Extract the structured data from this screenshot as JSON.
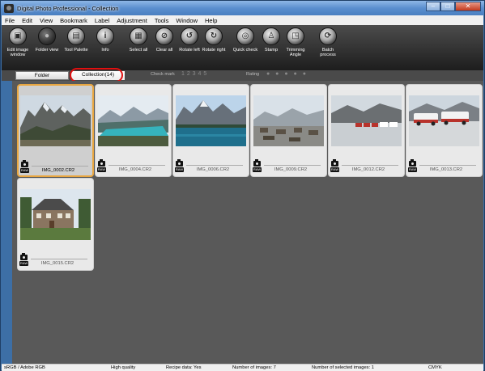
{
  "window": {
    "title": "Digital Photo Professional - Collection"
  },
  "menu": [
    "File",
    "Edit",
    "View",
    "Bookmark",
    "Label",
    "Adjustment",
    "Tools",
    "Window",
    "Help"
  ],
  "toolbar": [
    {
      "label": "Edit image window",
      "icon": "edit-image-icon",
      "glyph": "▣"
    },
    {
      "label": "Folder view",
      "icon": "folder-view-icon",
      "glyph": "●"
    },
    {
      "label": "Tool Palette",
      "icon": "tool-palette-icon",
      "glyph": "▤"
    },
    {
      "label": "Info",
      "icon": "info-icon",
      "glyph": "i"
    },
    {
      "label": "Select all",
      "icon": "select-all-icon",
      "glyph": "▦"
    },
    {
      "label": "Clear all",
      "icon": "clear-all-icon",
      "glyph": "⊘"
    },
    {
      "label": "Rotate left",
      "icon": "rotate-left-icon",
      "glyph": "↺"
    },
    {
      "label": "Rotate right",
      "icon": "rotate-right-icon",
      "glyph": "↻"
    },
    {
      "label": "Quick check",
      "icon": "quick-check-icon",
      "glyph": "◎"
    },
    {
      "label": "Stamp",
      "icon": "stamp-icon",
      "glyph": "♙"
    },
    {
      "label": "Trimming Angle",
      "icon": "trimming-angle-icon",
      "glyph": "◳"
    },
    {
      "label": "Batch process",
      "icon": "batch-process-icon",
      "glyph": "⟳"
    }
  ],
  "tabs": {
    "folder": "Folder",
    "collection": "Collection(14)"
  },
  "filters": {
    "check_mark_label": "Check mark",
    "check_marks": "1 2 3 4 5",
    "rating_label": "Rating",
    "rating_dots": "● ● ● ● ●"
  },
  "thumbnails": [
    {
      "filename": "IMG_0002.CR2",
      "badge": "RAW",
      "selected": true,
      "scene": "mountain"
    },
    {
      "filename": "IMG_0004.CR2",
      "badge": "RAW",
      "selected": false,
      "scene": "lake"
    },
    {
      "filename": "IMG_0006.CR2",
      "badge": "RAW",
      "selected": false,
      "scene": "moraine"
    },
    {
      "filename": "IMG_0009.CR2",
      "badge": "RAW",
      "selected": false,
      "scene": "parking"
    },
    {
      "filename": "IMG_0012.CR2",
      "badge": "RAW",
      "selected": false,
      "scene": "glacier"
    },
    {
      "filename": "IMG_0013.CR2",
      "badge": "RAW",
      "selected": false,
      "scene": "buses"
    },
    {
      "filename": "IMG_0015.CR2",
      "badge": "RAW",
      "selected": false,
      "scene": "house"
    }
  ],
  "status": {
    "color_space": "sRGB / Adobe RGB",
    "quality": "High quality",
    "recipe": "Recipe data: Yes",
    "num_images": "Number of images: 7",
    "num_selected": "Number of selected images: 1",
    "cmyk": "CMYK"
  },
  "colors": {
    "selection": "#e8a640",
    "highlight_oval": "#e01010",
    "window_frame": "#3d6fa6"
  }
}
